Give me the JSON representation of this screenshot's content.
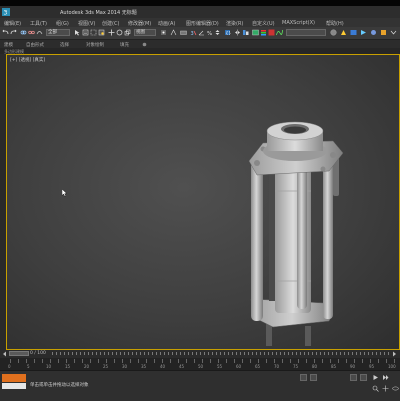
{
  "window": {
    "title": "Autodesk 3ds Max 2014   无标题"
  },
  "menubar": {
    "items": [
      "编辑(E)",
      "工具(T)",
      "组(G)",
      "视图(V)",
      "创建(C)",
      "修改器(M)",
      "动画(A)",
      "图形编辑器(D)",
      "渲染(R)",
      "自定义(U)",
      "MAXScript(X)",
      "帮助(H)"
    ]
  },
  "toolbar": {
    "selection_filter": "全部",
    "view_dropdown": "视图"
  },
  "ribbon": {
    "tabs": [
      "建模",
      "自由形式",
      "选择",
      "对象绘制",
      "填充"
    ]
  },
  "subribbon": {
    "label": "多边形建模"
  },
  "viewport": {
    "label": "[+] [透视] [真实]"
  },
  "timeslider": {
    "frame_text": "0 / 100"
  },
  "trackbar": {
    "tick_labels": [
      "0",
      "5",
      "10",
      "15",
      "20",
      "25",
      "30",
      "35",
      "40",
      "45",
      "50",
      "55",
      "60",
      "65",
      "70",
      "75",
      "80",
      "85",
      "90",
      "95",
      "100"
    ]
  },
  "statusbar": {
    "line1": "",
    "line2": "单击或单击并拖动以选择对象"
  },
  "colors": {
    "viewport_border": "#c8a000",
    "active_accent": "#e0701e"
  }
}
